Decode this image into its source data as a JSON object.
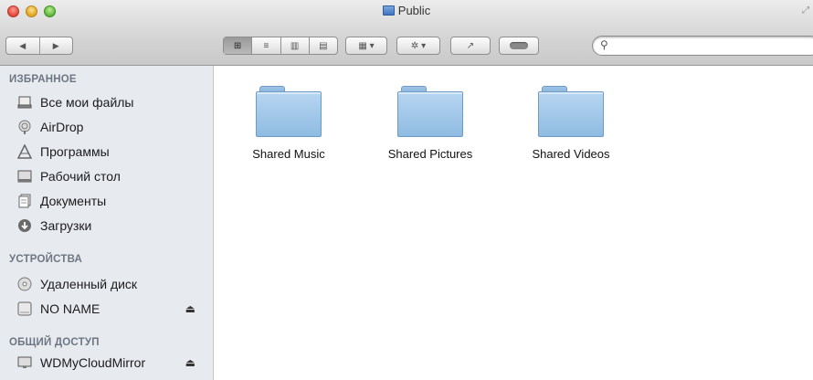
{
  "window": {
    "title": "Public"
  },
  "toolbar": {
    "nav_back": "◀",
    "nav_forward": "▶",
    "view_icons": [
      "⊞",
      "≡",
      "▥",
      "▤"
    ],
    "arrange_glyph": "▦ ▾",
    "action_glyph": "✲ ▾",
    "share_glyph": "↗",
    "search_placeholder": ""
  },
  "sidebar": {
    "favorites_header": "ИЗБРАННОЕ",
    "favorites": [
      {
        "label": "Все мои файлы",
        "icon": "all-files-icon"
      },
      {
        "label": "AirDrop",
        "icon": "airdrop-icon"
      },
      {
        "label": "Программы",
        "icon": "applications-icon"
      },
      {
        "label": "Рабочий стол",
        "icon": "desktop-icon"
      },
      {
        "label": "Документы",
        "icon": "documents-icon"
      },
      {
        "label": "Загрузки",
        "icon": "downloads-icon"
      }
    ],
    "devices_header": "УСТРОЙСТВА",
    "devices": [
      {
        "label": "Удаленный диск",
        "icon": "remote-disc-icon"
      },
      {
        "label": "NO NAME",
        "icon": "drive-icon"
      }
    ],
    "shared_header": "ОБЩИЙ ДОСТУП",
    "shared": [
      {
        "label": "WDMyCloudMirror",
        "icon": "network-display-icon"
      }
    ]
  },
  "files": [
    {
      "name": "Shared Music"
    },
    {
      "name": "Shared Pictures"
    },
    {
      "name": "Shared Videos"
    }
  ],
  "colors": {
    "folder": "#9fc6ea",
    "sidebar_bg": "#e7ebf0"
  }
}
